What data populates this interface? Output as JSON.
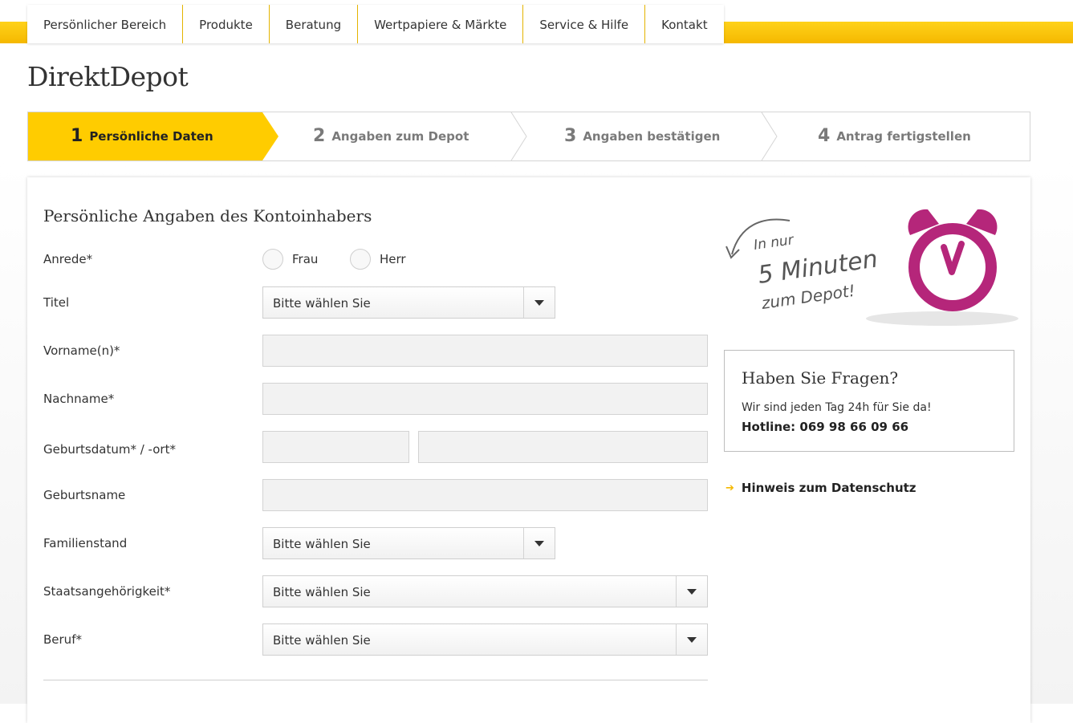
{
  "nav": {
    "items": [
      "Persönlicher Bereich",
      "Produkte",
      "Beratung",
      "Wertpapiere & Märkte",
      "Service & Hilfe",
      "Kontakt"
    ]
  },
  "page": {
    "title": "DirektDepot"
  },
  "steps": [
    {
      "num": "1",
      "label": "Persönliche Daten",
      "active": true
    },
    {
      "num": "2",
      "label": "Angaben zum Depot",
      "active": false
    },
    {
      "num": "3",
      "label": "Angaben bestätigen",
      "active": false
    },
    {
      "num": "4",
      "label": "Antrag fertigstellen",
      "active": false
    }
  ],
  "form": {
    "title": "Persönliche Angaben des Kontoinhabers",
    "anrede": {
      "label": "Anrede*",
      "options": [
        "Frau",
        "Herr"
      ]
    },
    "titel": {
      "label": "Titel",
      "value": "Bitte wählen Sie"
    },
    "vorname": {
      "label": "Vorname(n)*",
      "value": ""
    },
    "nachname": {
      "label": "Nachname*",
      "value": ""
    },
    "geburt": {
      "label": "Geburtsdatum* / -ort*",
      "date": "",
      "place": ""
    },
    "geburtsname": {
      "label": "Geburtsname",
      "value": ""
    },
    "familienstand": {
      "label": "Familienstand",
      "value": "Bitte wählen Sie"
    },
    "staat": {
      "label": "Staatsangehörigkeit*",
      "value": "Bitte wählen Sie"
    },
    "beruf": {
      "label": "Beruf*",
      "value": "Bitte wählen Sie"
    }
  },
  "promo": {
    "line1": "In nur",
    "line2": "5 Minuten",
    "line3": "zum Depot!"
  },
  "help": {
    "title": "Haben Sie Fragen?",
    "text": "Wir sind jeden Tag 24h für Sie da!",
    "hotline": "Hotline: 069 98 66 09 66"
  },
  "privacy": {
    "label": "Hinweis zum Datenschutz"
  },
  "colors": {
    "accent": "#ffcc00",
    "clock": "#b5267a"
  }
}
